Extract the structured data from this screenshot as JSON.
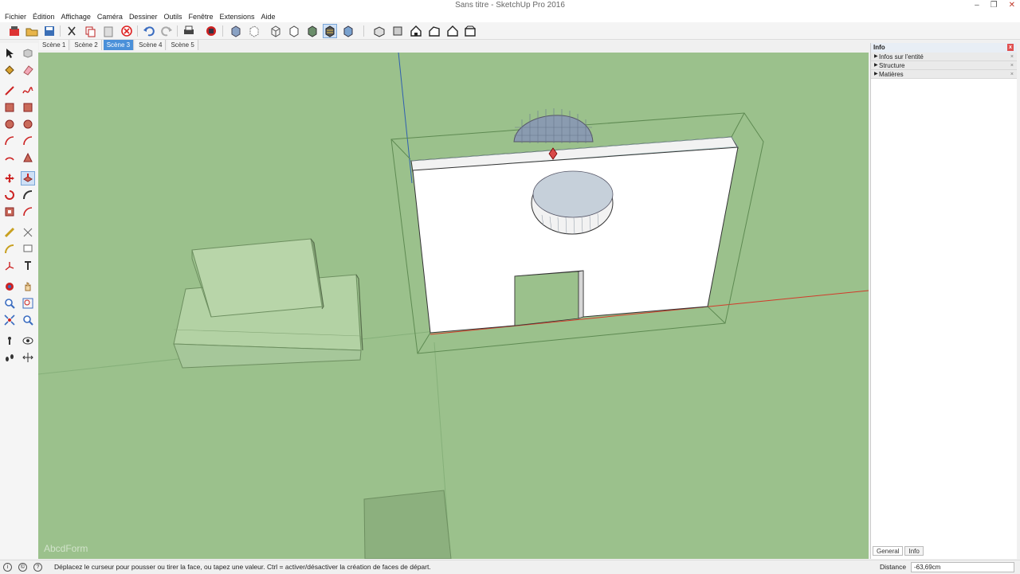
{
  "window": {
    "title": "Sans titre - SketchUp Pro 2016",
    "minimize": "–",
    "restore": "❐",
    "close": "✕"
  },
  "menu": [
    "Fichier",
    "Édition",
    "Affichage",
    "Caméra",
    "Dessiner",
    "Outils",
    "Fenêtre",
    "Extensions",
    "Aide"
  ],
  "scenes": [
    {
      "label": "Scène 1",
      "active": false
    },
    {
      "label": "Scène 2",
      "active": false
    },
    {
      "label": "Scène 3",
      "active": true
    },
    {
      "label": "Scène 4",
      "active": false
    },
    {
      "label": "Scène 5",
      "active": false
    }
  ],
  "toolbar_icons": [
    "3d-warehouse-icon",
    "open-icon",
    "save-icon",
    "cut-icon",
    "copy-icon",
    "paste-icon",
    "erase-icon",
    "undo-icon",
    "redo-icon",
    "print-icon",
    "model-info-icon",
    "xray-icon",
    "back-edges-icon",
    "wireframe-icon",
    "hidden-line-icon",
    "shaded-icon",
    "shaded-textures-icon",
    "monochrome-icon",
    "iso-view-icon",
    "top-view-icon",
    "front-view-icon",
    "right-view-icon",
    "back-view-icon",
    "left-view-icon"
  ],
  "left_tool_icons": [
    "select-icon",
    "make-component-icon",
    "paint-bucket-icon",
    "eraser-icon",
    "line-icon",
    "freehand-icon",
    "rectangle-icon",
    "rotated-rectangle-icon",
    "circle-icon",
    "polygon-icon",
    "arc-icon",
    "pie-icon",
    "two-point-arc-icon",
    "three-point-arc-icon",
    "move-icon",
    "push-pull-icon",
    "rotate-icon",
    "follow-me-icon",
    "scale-icon",
    "offset-icon",
    "tape-measure-icon",
    "dimension-icon",
    "protractor-icon",
    "text-icon",
    "axes-icon",
    "3d-text-icon",
    "orbit-icon",
    "pan-icon",
    "zoom-icon",
    "zoom-window-icon",
    "zoom-extents-icon",
    "previous-view-icon",
    "position-camera-icon",
    "look-around-icon",
    "walk-icon",
    "section-plane-icon"
  ],
  "viewport": {
    "background": "#9bc18c",
    "watermark": "AbcdForm"
  },
  "info_panel": {
    "title": "Info",
    "close": "x",
    "rows": [
      {
        "label": "Infos sur l'entité",
        "x": "×"
      },
      {
        "label": "Structure",
        "x": "×"
      },
      {
        "label": "Matières",
        "x": "×"
      }
    ],
    "tabs": [
      {
        "label": "General",
        "active": false
      },
      {
        "label": "Info",
        "active": true
      }
    ]
  },
  "status": {
    "message": "Déplacez le curseur pour pousser ou tirer la face, ou tapez une valeur.  Ctrl = activer/désactiver la création de faces de départ.",
    "icon1": "i",
    "icon2": "©",
    "icon3": "?",
    "distance_label": "Distance",
    "distance_value": "-63,69cm"
  }
}
